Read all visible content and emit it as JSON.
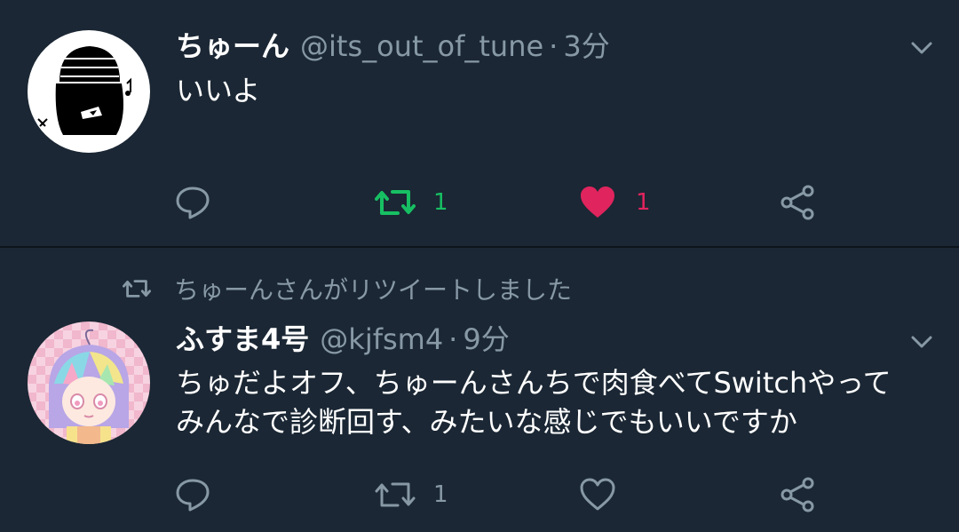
{
  "tweets": [
    {
      "display_name": "ちゅーん",
      "handle": "@its_out_of_tune",
      "separator": "·",
      "time": "3分",
      "text": [
        "いいよ"
      ],
      "actions": {
        "reply_icon": "reply-icon",
        "retweet_icon": "retweet-icon",
        "retweet_count": "1",
        "retweeted": true,
        "like_icon": "heart-icon",
        "like_count": "1",
        "liked": true,
        "share_icon": "share-icon"
      }
    },
    {
      "retweet_context": "ちゅーんさんがリツイートしました",
      "display_name": "ふすま4号",
      "handle": "@kjfsm4",
      "separator": "·",
      "time": "9分",
      "text": [
        "ちゅだよオフ、ちゅーんさんちで肉食べてSwitchやって",
        "みんなで診断回す、みたいな感じでもいいですか"
      ],
      "actions": {
        "reply_icon": "reply-icon",
        "retweet_icon": "retweet-icon",
        "retweet_count": "1",
        "retweeted": false,
        "like_icon": "heart-outline-icon",
        "liked": false,
        "share_icon": "share-icon"
      }
    }
  ],
  "colors": {
    "background": "#1b2734",
    "divider": "#0e141b",
    "text_primary": "#ffffff",
    "text_secondary": "#8899a6",
    "retweet_active": "#17bf63",
    "like_active": "#e0245e"
  }
}
